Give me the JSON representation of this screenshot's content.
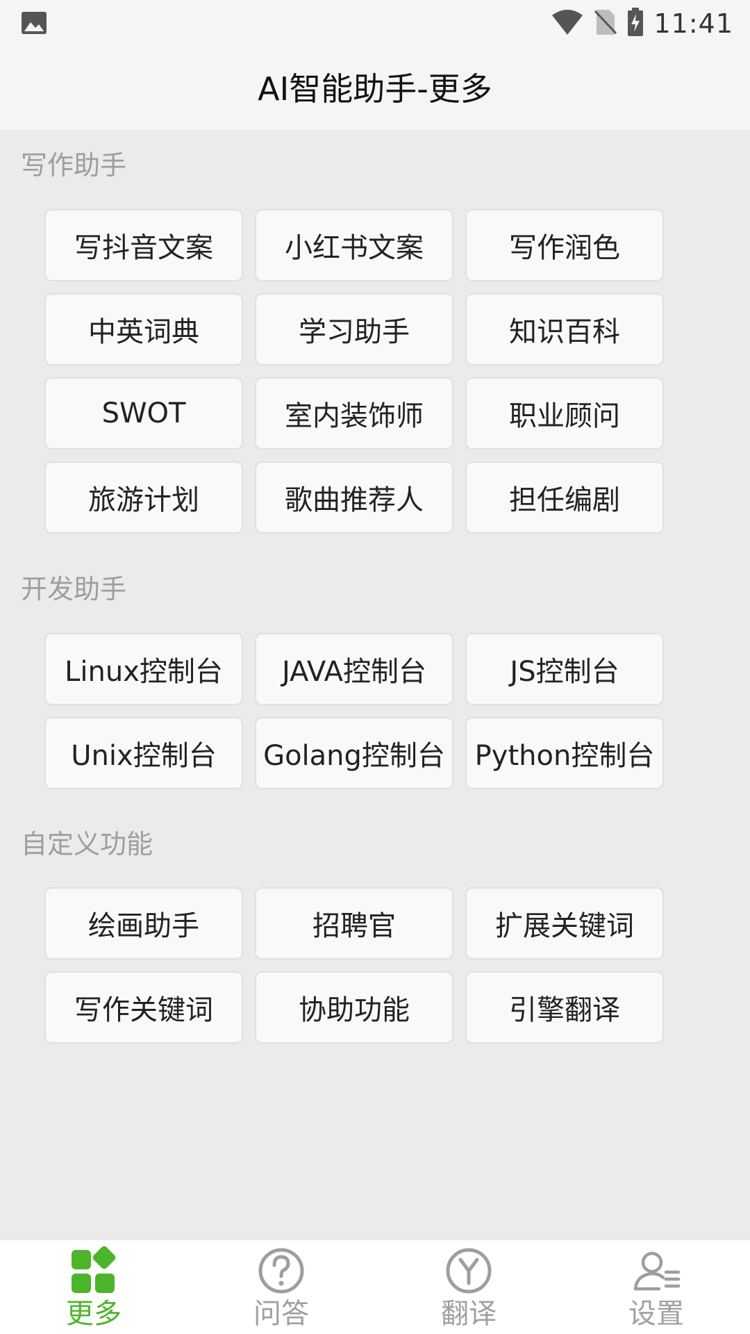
{
  "status_bar": {
    "time": "11:41",
    "icons": [
      "image-icon",
      "wifi-icon",
      "no-sim-icon",
      "battery-charging-icon"
    ]
  },
  "header": {
    "title": "AI智能助手-更多"
  },
  "sections": [
    {
      "title": "写作助手",
      "items": [
        "写抖音文案",
        "小红书文案",
        "写作润色",
        "中英词典",
        "学习助手",
        "知识百科",
        "SWOT",
        "室内装饰师",
        "职业顾问",
        "旅游计划",
        "歌曲推荐人",
        "担任编剧"
      ]
    },
    {
      "title": "开发助手",
      "items": [
        "Linux控制台",
        "JAVA控制台",
        "JS控制台",
        "Unix控制台",
        "Golang控制台",
        "Python控制台"
      ]
    },
    {
      "title": "自定义功能",
      "items": [
        "绘画助手",
        "招聘官",
        "扩展关键词",
        "写作关键词",
        "协助功能",
        "引擎翻译"
      ]
    }
  ],
  "bottom_nav": [
    {
      "label": "更多",
      "icon": "grid-apps-icon",
      "active": true
    },
    {
      "label": "问答",
      "icon": "question-circle-icon",
      "active": false
    },
    {
      "label": "翻译",
      "icon": "translate-y-icon",
      "active": false
    },
    {
      "label": "设置",
      "icon": "user-settings-icon",
      "active": false
    }
  ],
  "colors": {
    "accent": "#4cb52a",
    "inactive": "#a0a0a0",
    "background": "#ebebeb"
  }
}
